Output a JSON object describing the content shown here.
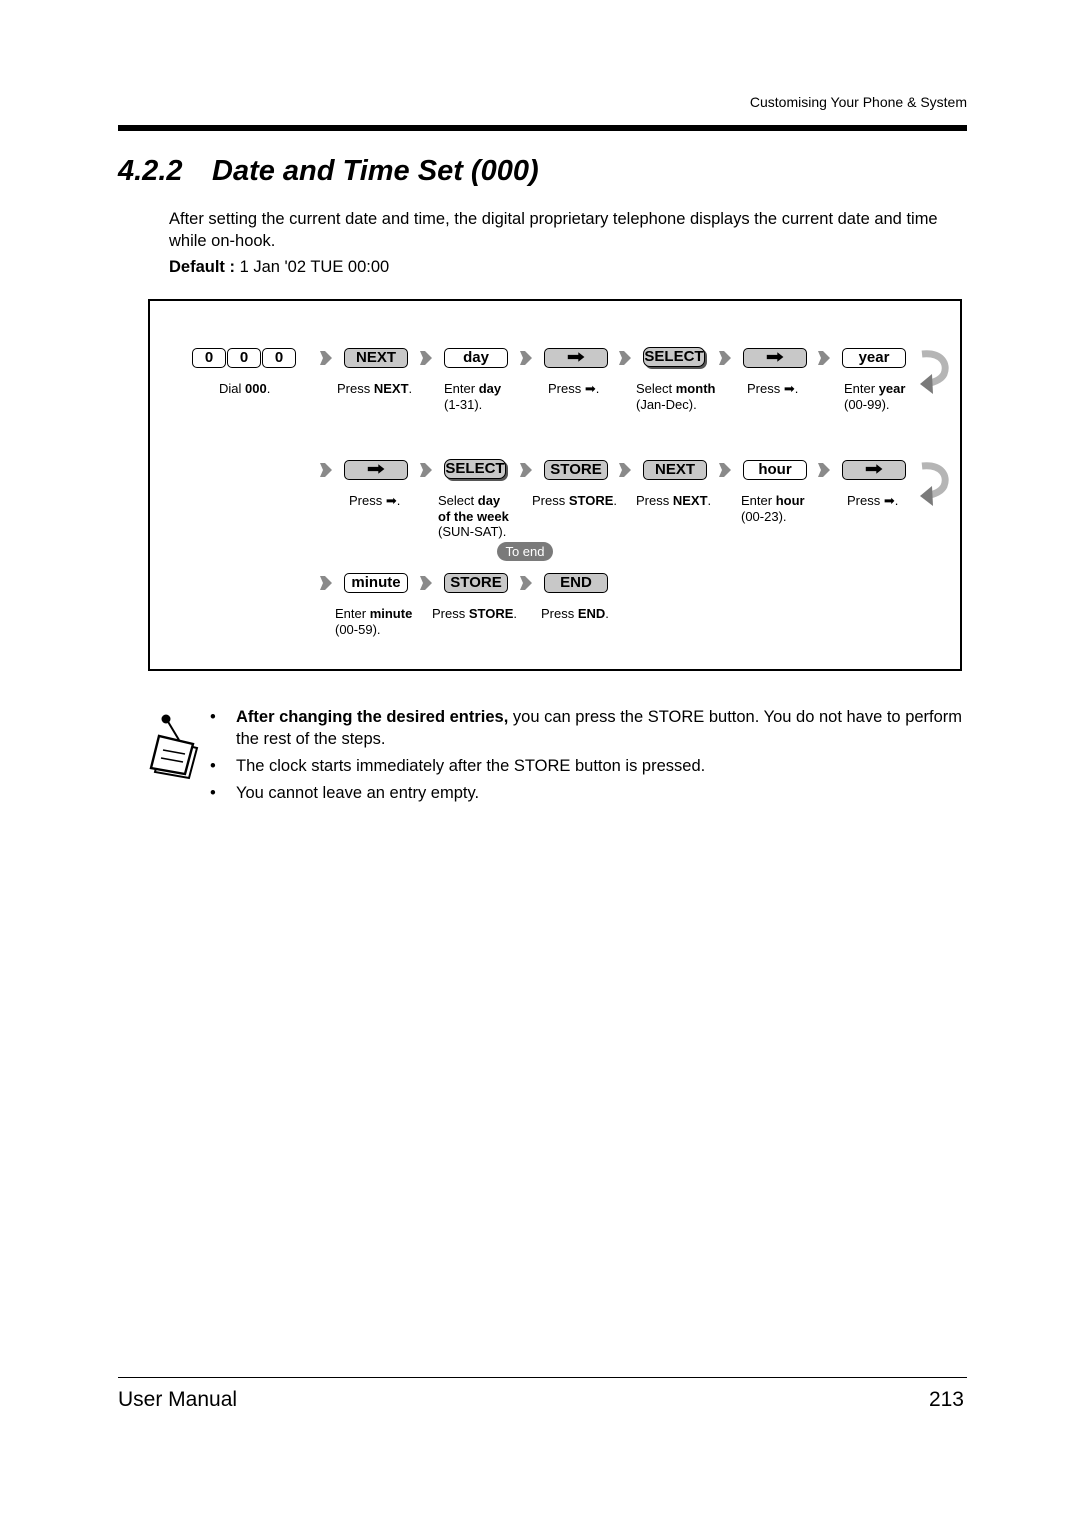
{
  "header": {
    "running_head": "Customising Your Phone & System"
  },
  "section": {
    "number": "4.2.2",
    "title": "Date and Time Set (000)",
    "intro": "After setting the current date and time, the digital proprietary telephone displays the current date and time while on-hook.",
    "default_label": "Default :",
    "default_value": " 1 Jan '02 TUE 00:00"
  },
  "procedure": {
    "row1": {
      "keys": {
        "digits": [
          "0",
          "0",
          "0"
        ],
        "next": "NEXT",
        "day": "day",
        "arrow1": "➡",
        "select": "SELECT",
        "arrow2": "➡",
        "year": "year"
      },
      "captions": {
        "dial": {
          "pre": "Dial ",
          "bold": "000",
          "post": "."
        },
        "next": {
          "pre": "Press ",
          "bold": "NEXT",
          "post": "."
        },
        "day": {
          "pre": "Enter ",
          "bold": "day",
          "post": "",
          "range": "(1-31)."
        },
        "arrow1": {
          "pre": "Press ",
          "bold": "",
          "post": "➡."
        },
        "select": {
          "pre": "Select ",
          "bold": "month",
          "post": "",
          "range": "(Jan-Dec)."
        },
        "arrow2": {
          "pre": "Press ",
          "bold": "",
          "post": "➡."
        },
        "year": {
          "pre": "Enter ",
          "bold": "year",
          "post": "",
          "range": "(00-99)."
        }
      }
    },
    "row2": {
      "keys": {
        "arrow1": "➡",
        "select": "SELECT",
        "store": "STORE",
        "next": "NEXT",
        "hour": "hour",
        "arrow2": "➡"
      },
      "captions": {
        "arrow1": {
          "pre": "Press ",
          "post": "➡."
        },
        "select": {
          "pre": "Select ",
          "bold": "day",
          "bold2": "of the week",
          "range": "(SUN-SAT)."
        },
        "store": {
          "pre": "Press ",
          "bold": "STORE",
          "post": "."
        },
        "next": {
          "pre": "Press ",
          "bold": "NEXT",
          "post": "."
        },
        "hour": {
          "pre": "Enter ",
          "bold": "hour",
          "range": "(00-23)."
        },
        "arrow2": {
          "pre": "Press ",
          "post": "➡."
        }
      },
      "to_end": "To end"
    },
    "row3": {
      "keys": {
        "minute": "minute",
        "store": "STORE",
        "end": "END"
      },
      "captions": {
        "minute": {
          "pre": "Enter ",
          "bold": "minute",
          "range": "(00-59)."
        },
        "store": {
          "pre": "Press ",
          "bold": "STORE",
          "post": "."
        },
        "end": {
          "pre": "Press ",
          "bold": "END",
          "post": "."
        }
      }
    },
    "icons": {
      "flow": "flow-arrow-icon",
      "continue": "return-arrow-icon",
      "note": "note-pad-icon"
    }
  },
  "notes": {
    "bullet": "•",
    "items": [
      {
        "bold": "After changing the desired entries,",
        "text": " you can press the STORE button. You do not have to perform the rest of the steps."
      },
      {
        "bold": "",
        "text": "The clock starts immediately after the STORE button is pressed."
      },
      {
        "bold": "",
        "text": "You cannot leave an entry empty."
      }
    ]
  },
  "footer": {
    "title": "User Manual",
    "page": "213"
  }
}
